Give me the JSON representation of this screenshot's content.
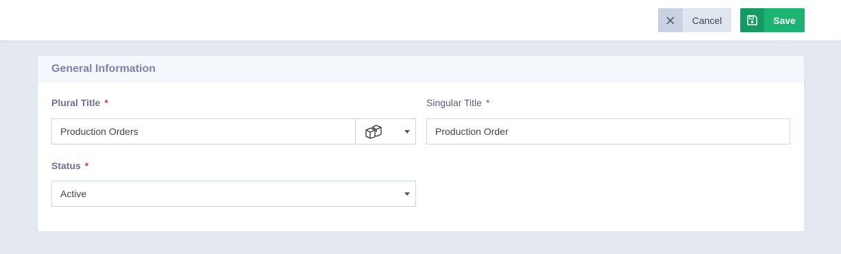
{
  "toolbar": {
    "cancel_label": "Cancel",
    "save_label": "Save",
    "cancel_icon": "close-icon",
    "save_icon": "floppy-disk-icon"
  },
  "card": {
    "title": "General Information",
    "plural_title": {
      "label": "Plural Title",
      "required_mark": "*",
      "value": "Production Orders",
      "icon": "boxes-icon"
    },
    "singular_title": {
      "label": "Singular Title",
      "required_mark": "*",
      "value": "Production Order"
    },
    "status": {
      "label": "Status",
      "required_mark": "*",
      "value": "Active"
    }
  },
  "colors": {
    "background": "#e4e9f1",
    "save_green": "#1bb472",
    "required_red": "#e2334b",
    "section_title": "#7e83ad"
  }
}
